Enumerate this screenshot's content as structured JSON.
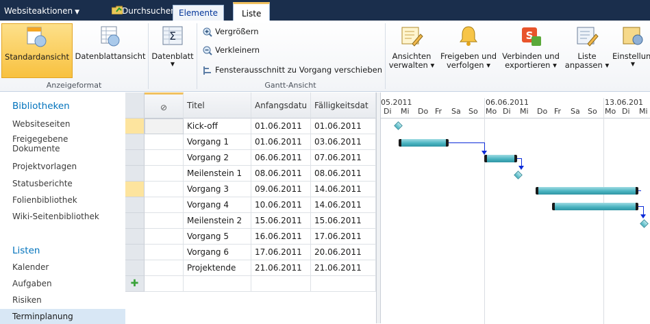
{
  "topbar": {
    "site_actions": "Websiteaktionen",
    "browse": "Durchsuchen",
    "items_tab": "Elemente",
    "list_tab": "Liste"
  },
  "ribbon": {
    "standard_view": "Standardansicht",
    "datasheet_view": "Datenblattansicht",
    "datasheet": "Datenblatt",
    "zoom_in": "Vergrößern",
    "zoom_out": "Verkleinern",
    "scroll_to_task": "Fensterausschnitt zu Vorgang verschieben",
    "manage_views": [
      "Ansichten",
      "verwalten"
    ],
    "share_track": [
      "Freigeben und",
      "verfolgen"
    ],
    "connect_export": [
      "Verbinden und",
      "exportieren"
    ],
    "customize_list": [
      "Liste",
      "anpassen"
    ],
    "settings": "Einstellun",
    "group_format": "Anzeigeformat",
    "group_gantt": "Gantt-Ansicht"
  },
  "nav": {
    "libraries_head": "Bibliotheken",
    "libraries": [
      "Websiteseiten",
      "Freigegebene Dokumente",
      "Projektvorlagen",
      "Statusberichte",
      "Folienbibliothek",
      "Wiki-Seitenbibliothek"
    ],
    "lists_head": "Listen",
    "lists": [
      "Kalender",
      "Aufgaben",
      "Risiken"
    ],
    "selected": "Terminplanung"
  },
  "grid": {
    "columns": [
      "Titel",
      "Anfangsdatu",
      "Fälligkeitsdat"
    ],
    "rows": [
      {
        "title": "Kick-off",
        "start": "01.06.2011",
        "due": "01.06.2011"
      },
      {
        "title": "Vorgang 1",
        "start": "01.06.2011",
        "due": "03.06.2011"
      },
      {
        "title": "Vorgang 2",
        "start": "06.06.2011",
        "due": "07.06.2011"
      },
      {
        "title": "Meilenstein 1",
        "start": "08.06.2011",
        "due": "08.06.2011"
      },
      {
        "title": "Vorgang 3",
        "start": "09.06.2011",
        "due": "14.06.2011"
      },
      {
        "title": "Vorgang 4",
        "start": "10.06.2011",
        "due": "14.06.2011"
      },
      {
        "title": "Meilenstein 2",
        "start": "15.06.2011",
        "due": "15.06.2011"
      },
      {
        "title": "Vorgang 5",
        "start": "16.06.2011",
        "due": "17.06.2011"
      },
      {
        "title": "Vorgang 6",
        "start": "17.06.2011",
        "due": "20.06.2011"
      },
      {
        "title": "Projektende",
        "start": "21.06.2011",
        "due": "21.06.2011"
      }
    ]
  },
  "gantt": {
    "weeks": [
      "05.2011",
      "06.06.2011",
      "13.06.201"
    ],
    "days": [
      "Di",
      "Mi",
      "Do",
      "Fr",
      "Sa",
      "So",
      "Mo",
      "Di",
      "Mi",
      "Do",
      "Fr",
      "Sa",
      "So",
      "Mo",
      "Di",
      "Mi"
    ]
  },
  "colors": {
    "topbar": "#1a2e4c",
    "accent": "#0072bc",
    "bar": "#4ab4c1",
    "link": "#0b2bd8",
    "selected": "#f8c13f"
  }
}
